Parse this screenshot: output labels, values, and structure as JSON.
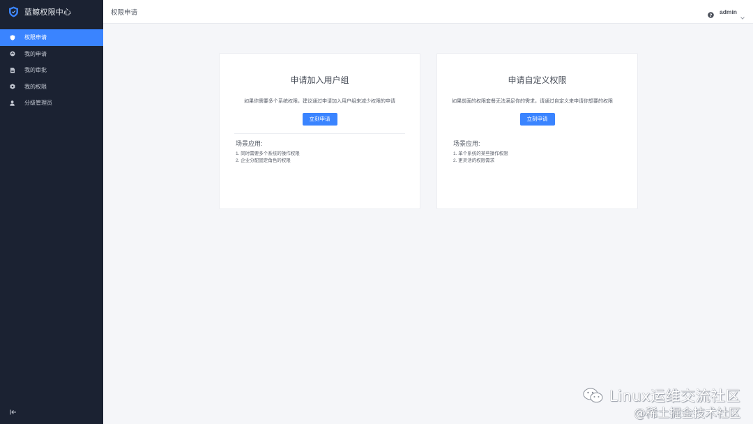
{
  "app": {
    "title": "蓝鲸权限中心"
  },
  "sidebar": {
    "items": [
      {
        "label": "权限申请",
        "icon": "shield-icon",
        "active": true
      },
      {
        "label": "我的申请",
        "icon": "circle-icon",
        "active": false
      },
      {
        "label": "我的审批",
        "icon": "document-icon",
        "active": false
      },
      {
        "label": "我的权限",
        "icon": "badge-icon",
        "active": false
      },
      {
        "label": "分级管理员",
        "icon": "user-icon",
        "active": false
      }
    ],
    "collapse_icon": "collapse-icon"
  },
  "header": {
    "title": "权限申请",
    "user": {
      "name": "admin",
      "help_icon": "help-icon",
      "chevron_icon": "chevron-down-icon"
    }
  },
  "cards": [
    {
      "title": "申请加入用户组",
      "description": "如果你需要多个系统权限，建议通过申请加入用户组来减少权限的申请",
      "button": "立刻申请",
      "scenario_title": "场景应用:",
      "scenarios": [
        "1. 同时需要多个系统的操作权限",
        "2. 企业分配固定角色的权限"
      ]
    },
    {
      "title": "申请自定义权限",
      "description": "如果前面的权限套餐无法满足你的需求，请通过自定义来申请你想要的权限",
      "button": "立刻申请",
      "scenario_title": "场景应用:",
      "scenarios": [
        "1. 单个系统的某些操作权限",
        "2. 更灵活的权限需求"
      ]
    }
  ],
  "watermark": {
    "line1": "Linux运维交流社区",
    "line2": "@稀土掘金技术社区",
    "icon": "wechat-icon"
  },
  "colors": {
    "sidebar_bg": "#1b2232",
    "accent": "#3a84ff",
    "content_bg": "#f5f6f9"
  }
}
